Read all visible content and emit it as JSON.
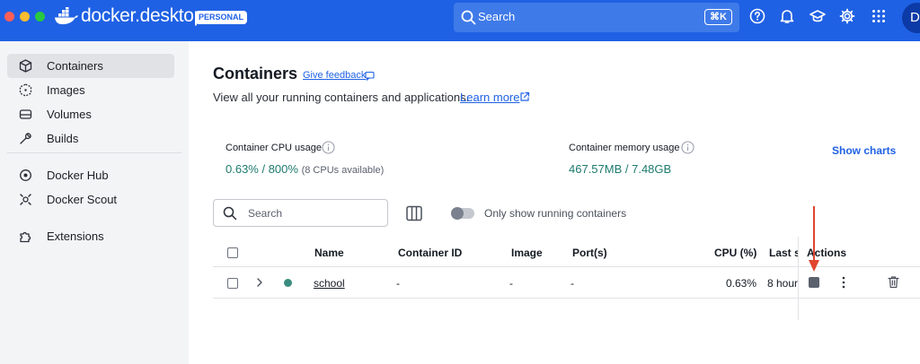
{
  "app": {
    "brand": "docker.desktop",
    "badge": "PERSONAL",
    "search_placeholder": "Search",
    "search_shortcut": "⌘K",
    "avatar_initial": "D"
  },
  "top_icons": [
    "help-icon",
    "bell-icon",
    "learn-icon",
    "settings-icon",
    "grid-apps-icon"
  ],
  "sidebar": {
    "items": [
      {
        "label": "Containers",
        "icon": "cube-icon",
        "active": true
      },
      {
        "label": "Images",
        "icon": "images-icon",
        "active": false
      },
      {
        "label": "Volumes",
        "icon": "volumes-icon",
        "active": false
      },
      {
        "label": "Builds",
        "icon": "wrench-icon",
        "active": false
      },
      {
        "label": "Docker Hub",
        "icon": "hub-icon",
        "active": false
      },
      {
        "label": "Docker Scout",
        "icon": "scout-icon",
        "active": false
      },
      {
        "label": "Extensions",
        "icon": "puzzle-icon",
        "active": false
      }
    ]
  },
  "page": {
    "title": "Containers",
    "feedback": "Give feedback",
    "subtitle": "View all your running containers and applications.",
    "learn_more": "Learn more"
  },
  "stats": {
    "cpu_label": "Container CPU usage",
    "cpu_value": "0.63% / 800%",
    "cpu_note": "(8 CPUs available)",
    "mem_label": "Container memory usage",
    "mem_value": "467.57MB / 7.48GB",
    "show_charts": "Show charts"
  },
  "toolbar": {
    "search_placeholder": "Search",
    "toggle_label": "Only show running containers",
    "toggle_on": false
  },
  "table": {
    "columns": [
      "Name",
      "Container ID",
      "Image",
      "Port(s)",
      "CPU (%)",
      "Last s",
      "Actions"
    ],
    "rows": [
      {
        "name": "school",
        "container_id": "-",
        "image": "-",
        "ports": "-",
        "cpu": "0.63%",
        "last_started": "8 hour",
        "status": "running"
      }
    ]
  },
  "colors": {
    "brand_blue": "#1f61e4",
    "running_green": "#3a8d7e",
    "annotation_red": "#e0452f"
  }
}
